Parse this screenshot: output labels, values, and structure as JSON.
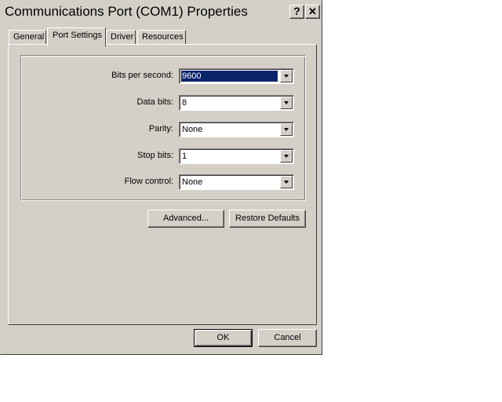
{
  "window": {
    "title": "Communications Port (COM1) Properties",
    "help_label": "?",
    "close_label": "✕"
  },
  "tabs": [
    {
      "label": "General",
      "active": false
    },
    {
      "label": "Port Settings",
      "active": true
    },
    {
      "label": "Driver",
      "active": false
    },
    {
      "label": "Resources",
      "active": false
    }
  ],
  "port_settings": {
    "bits_per_second": {
      "label": "Bits per second:",
      "value": "9600"
    },
    "data_bits": {
      "label": "Data bits:",
      "value": "8"
    },
    "parity": {
      "label": "Parity:",
      "value": "None"
    },
    "stop_bits": {
      "label": "Stop bits:",
      "value": "1"
    },
    "flow_control": {
      "label": "Flow control:",
      "value": "None"
    }
  },
  "buttons": {
    "advanced": "Advanced...",
    "restore_defaults": "Restore Defaults",
    "ok": "OK",
    "cancel": "Cancel"
  }
}
